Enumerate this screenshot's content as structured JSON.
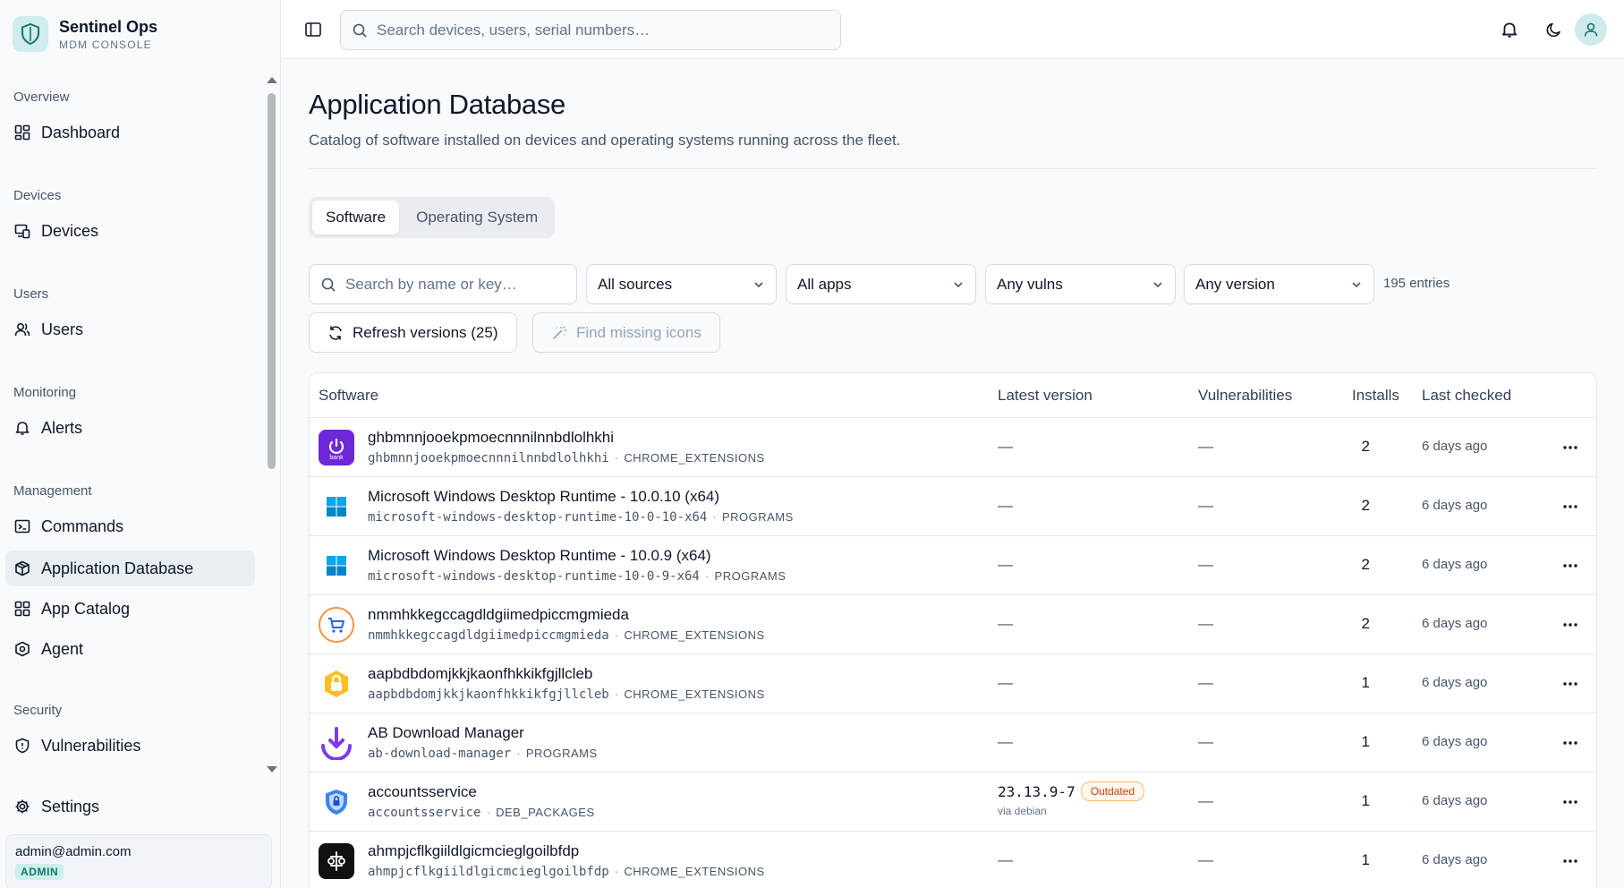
{
  "brand": {
    "title": "Sentinel Ops",
    "subtitle": "MDM CONSOLE"
  },
  "sidebar": {
    "sections": [
      {
        "label": "Overview",
        "items": [
          {
            "label": "Dashboard",
            "icon": "dashboard-icon"
          }
        ]
      },
      {
        "label": "Devices",
        "items": [
          {
            "label": "Devices",
            "icon": "devices-icon"
          }
        ]
      },
      {
        "label": "Users",
        "items": [
          {
            "label": "Users",
            "icon": "users-icon"
          }
        ]
      },
      {
        "label": "Monitoring",
        "items": [
          {
            "label": "Alerts",
            "icon": "bell-icon"
          }
        ]
      },
      {
        "label": "Management",
        "items": [
          {
            "label": "Commands",
            "icon": "terminal-icon"
          },
          {
            "label": "Application Database",
            "icon": "package-icon",
            "active": true
          },
          {
            "label": "App Catalog",
            "icon": "grid-icon"
          },
          {
            "label": "Agent",
            "icon": "agent-icon"
          }
        ]
      },
      {
        "label": "Security",
        "items": [
          {
            "label": "Vulnerabilities",
            "icon": "shield-icon"
          }
        ]
      }
    ],
    "settings_label": "Settings",
    "user": {
      "email": "admin@admin.com",
      "role": "ADMIN"
    }
  },
  "topbar": {
    "search_placeholder": "Search devices, users, serial numbers…"
  },
  "page": {
    "title": "Application Database",
    "description": "Catalog of software installed on devices and operating systems running across the fleet."
  },
  "tabs": [
    {
      "label": "Software",
      "active": true
    },
    {
      "label": "Operating System",
      "active": false
    }
  ],
  "filters": {
    "search_placeholder": "Search by name or key…",
    "source": "All sources",
    "apps": "All apps",
    "vulns": "Any vulns",
    "version": "Any version",
    "entries": "195 entries"
  },
  "actions": {
    "refresh": "Refresh versions (25)",
    "find_icons": "Find missing icons"
  },
  "table": {
    "headers": {
      "software": "Software",
      "latest": "Latest version",
      "vulns": "Vulnerabilities",
      "installs": "Installs",
      "checked": "Last checked"
    },
    "rows": [
      {
        "name": "ghbmnnjooekpmoecnnnilnnbdlolhkhi",
        "key": "ghbmnnjooekpmoecnnnilnnbdlolhkhi",
        "source": "CHROME_EXTENSIONS",
        "latest": "—",
        "vulns": "—",
        "installs": "2",
        "checked": "6 days ago",
        "icon": "bank-icon"
      },
      {
        "name": "Microsoft Windows Desktop Runtime - 10.0.10 (x64)",
        "key": "microsoft-windows-desktop-runtime-10-0-10-x64",
        "source": "PROGRAMS",
        "latest": "—",
        "vulns": "—",
        "installs": "2",
        "checked": "6 days ago",
        "icon": "windows-icon"
      },
      {
        "name": "Microsoft Windows Desktop Runtime - 10.0.9 (x64)",
        "key": "microsoft-windows-desktop-runtime-10-0-9-x64",
        "source": "PROGRAMS",
        "latest": "—",
        "vulns": "—",
        "installs": "2",
        "checked": "6 days ago",
        "icon": "windows-icon"
      },
      {
        "name": "nmmhkkegccagdldgiimedpiccmgmieda",
        "key": "nmmhkkegccagdldgiimedpiccmgmieda",
        "source": "CHROME_EXTENSIONS",
        "latest": "—",
        "vulns": "—",
        "installs": "2",
        "checked": "6 days ago",
        "icon": "cart-icon"
      },
      {
        "name": "aapbdbdomjkkjkaonfhkkikfgjllcleb",
        "key": "aapbdbdomjkkjkaonfhkkikfgjllcleb",
        "source": "CHROME_EXTENSIONS",
        "latest": "—",
        "vulns": "—",
        "installs": "1",
        "checked": "6 days ago",
        "icon": "lock-badge-icon"
      },
      {
        "name": "AB Download Manager",
        "key": "ab-download-manager",
        "source": "PROGRAMS",
        "latest": "—",
        "vulns": "—",
        "installs": "1",
        "checked": "6 days ago",
        "icon": "download-icon"
      },
      {
        "name": "accountsservice",
        "key": "accountsservice",
        "source": "DEB_PACKAGES",
        "latest_version": "23.13.9-7",
        "latest_badge": "Outdated",
        "latest_via": "via debian",
        "vulns": "—",
        "installs": "1",
        "checked": "6 days ago",
        "icon": "shield-lock-icon"
      },
      {
        "name": "ahmpjcflkgiildlgicmcieglgoilbfdp",
        "key": "ahmpjcflkgiildlgicmcieglgoilbfdp",
        "source": "CHROME_EXTENSIONS",
        "latest": "—",
        "vulns": "—",
        "installs": "1",
        "checked": "6 days ago",
        "icon": "symbol-icon"
      }
    ]
  },
  "colors": {
    "accent": "#0f766e",
    "outdated": "#c2410c",
    "active_nav": "#e9eef3"
  }
}
